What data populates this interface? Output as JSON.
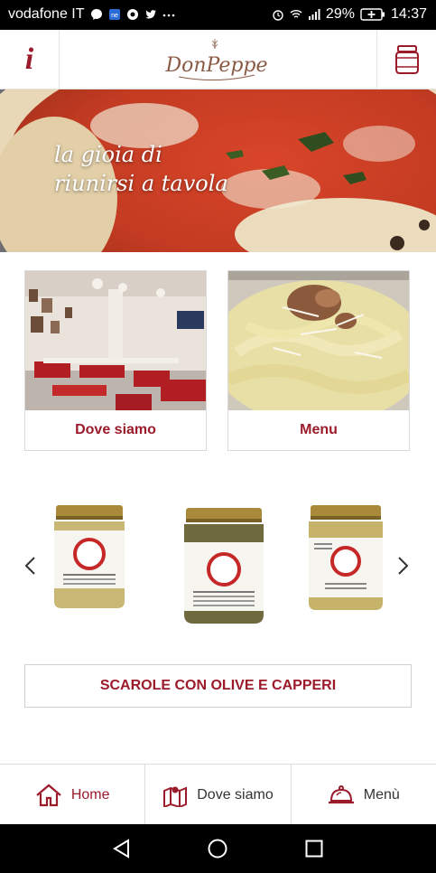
{
  "status_bar": {
    "carrier": "vodafone IT",
    "battery": "29%",
    "time": "14:37",
    "icons": [
      "messenger-icon",
      "notification-app-icon",
      "chrome-icon",
      "twitter-icon",
      "more-icon",
      "alarm-icon",
      "wifi-icon",
      "signal-icon",
      "battery-charging-icon"
    ]
  },
  "header": {
    "info_glyph": "i",
    "logo_text": "DonPeppe",
    "jar_icon": "jar-icon"
  },
  "hero": {
    "line1": "la gioia di",
    "line2": "riunirsi a tavola"
  },
  "cards": [
    {
      "label": "Dove siamo"
    },
    {
      "label": "Menu"
    }
  ],
  "carousel": {
    "prev_icon": "chevron-left-icon",
    "next_icon": "chevron-right-icon",
    "current_product": "SCAROLE CON OLIVE E CAPPERI"
  },
  "bottom_nav": [
    {
      "label": "Home",
      "icon": "home-icon",
      "active": true
    },
    {
      "label": "Dove siamo",
      "icon": "map-icon",
      "active": false
    },
    {
      "label": "Menù",
      "icon": "cloche-icon",
      "active": false
    }
  ],
  "colors": {
    "accent": "#9b1b2b",
    "text": "#333333",
    "border": "#dedede"
  }
}
